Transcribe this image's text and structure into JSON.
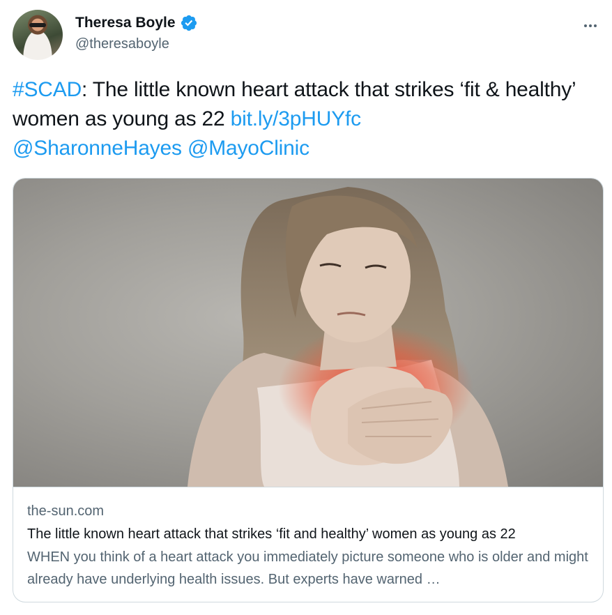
{
  "author": {
    "name": "Theresa Boyle",
    "handle": "@theresaboyle",
    "verified": true
  },
  "tweet": {
    "hashtag": "#SCAD",
    "text": ": The little known heart attack that strikes ‘fit & healthy’ women as young as 22 ",
    "url": "bit.ly/3pHUYfc",
    "mention_1": "@SharonneHayes",
    "mention_2": "@MayoClinic"
  },
  "card": {
    "domain": "the-sun.com",
    "title": "The little known heart attack that strikes ‘fit and healthy’ women as young as 22",
    "description": "WHEN you think of a heart attack you immediately picture someone who is older and might already have underlying health issues. But experts have warned …"
  },
  "colors": {
    "link": "#1d9bf0",
    "text": "#0f1419",
    "secondary": "#536471",
    "border": "#cfd9de"
  },
  "icons": {
    "verified": "verified-badge-icon",
    "more": "more-horizontal-icon"
  }
}
